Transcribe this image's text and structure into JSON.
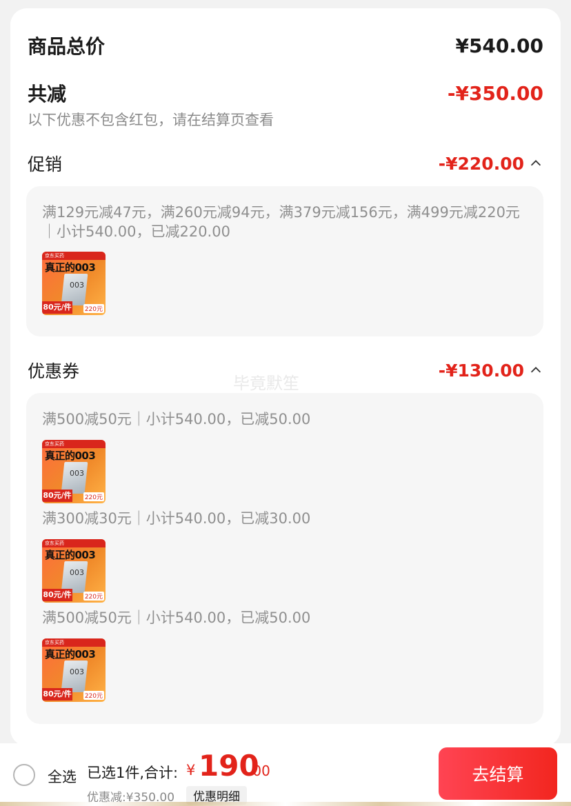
{
  "summary": {
    "total_label": "商品总价",
    "total_value": "¥540.00",
    "reduce_label": "共减",
    "reduce_value": "-¥350.00",
    "note": "以下优惠不包含红包，请在结算页查看"
  },
  "promotion": {
    "label": "促销",
    "value": "-¥220.00",
    "rule": "满129元减47元，满260元减94元，满379元减156元，满499元减220元｜小计540.00，已减220.00"
  },
  "coupons": {
    "label": "优惠券",
    "value": "-¥130.00",
    "items": [
      {
        "rule": "满500减50元｜小计540.00，已减50.00"
      },
      {
        "rule": "满300减30元｜小计540.00，已减30.00"
      },
      {
        "rule": "满500减50元｜小计540.00，已减50.00"
      }
    ]
  },
  "product_thumb": {
    "headline": "真正的003",
    "box_label": "003",
    "top_text": "京东买药",
    "badge": "80元/件",
    "price_tag": "220元"
  },
  "watermark": "毕竟默笙",
  "footer": {
    "select_all": "全选",
    "selected_text": "已选1件,合计:",
    "currency": "¥",
    "total_int": "190",
    "total_dec": ".00",
    "discount_text": "优惠减:¥350.00",
    "detail_btn": "优惠明细",
    "checkout_btn": "去结算"
  },
  "colors": {
    "accent_red": "#e2231a",
    "checkout_start": "#ff4453",
    "checkout_end": "#f2261f"
  }
}
